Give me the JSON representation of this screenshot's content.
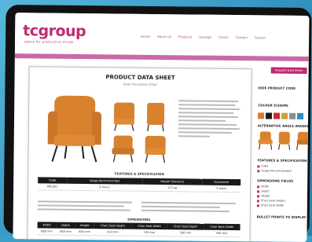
{
  "brand": {
    "logo_tc": "tc",
    "logo_group": "group",
    "tagline": "space for productive minds"
  },
  "nav": [
    "Home",
    "About Us",
    "Products",
    "Storage",
    "Chairs",
    "Contact",
    "Search"
  ],
  "sheet": {
    "title": "PRODUCT DATA SHEET",
    "subtitle": "Pearl Reception Chair",
    "features_title": "FEATURES & SPECIFICATION",
    "spec_headers": [
      "Code",
      "Usage Recommended",
      "Weight Tolerance",
      "Guarantee"
    ],
    "spec_row": [
      "PRCE01",
      "6 hours",
      "175 kg",
      "3 years"
    ],
    "dimensions_title": "DIMENSIONS",
    "dim_headers": [
      "Width",
      "Depth",
      "Height",
      "Chair Seat Height",
      "Chair Seat Width",
      "Chair Seat Depth",
      "Chair Back Width"
    ],
    "dim_row": [
      "680 mm",
      "660 mm",
      "800 mm",
      "450 mm",
      "520 mm",
      "500 mm",
      "590 mm"
    ]
  },
  "side": {
    "button_label": "Request Data Sheet",
    "product_code_label": "HIDE PRODUCT CODE",
    "colour_label": "COLOUR SCHEME",
    "alt_images_label": "ALTERNATIVE ANGLE IMAGES",
    "features_label": "FEATURES & SPECIFICATION",
    "feature_items": [
      "Code",
      "Usage Recommended"
    ],
    "dimensions_label": "DIMENSIONS FIELDS",
    "dimension_items": [
      "Width",
      "Depth",
      "Height",
      "Chair Seat Height",
      "Chair Seat Width"
    ],
    "bullets_label": "BULLET POINTS TO DISPLAY",
    "swatch_colors": [
      "#e07a2a",
      "#1a1a1a",
      "#d0282a",
      "#c9a23a",
      "#8a8f94",
      "#2f8fbd"
    ]
  },
  "accent": "#c12a75"
}
